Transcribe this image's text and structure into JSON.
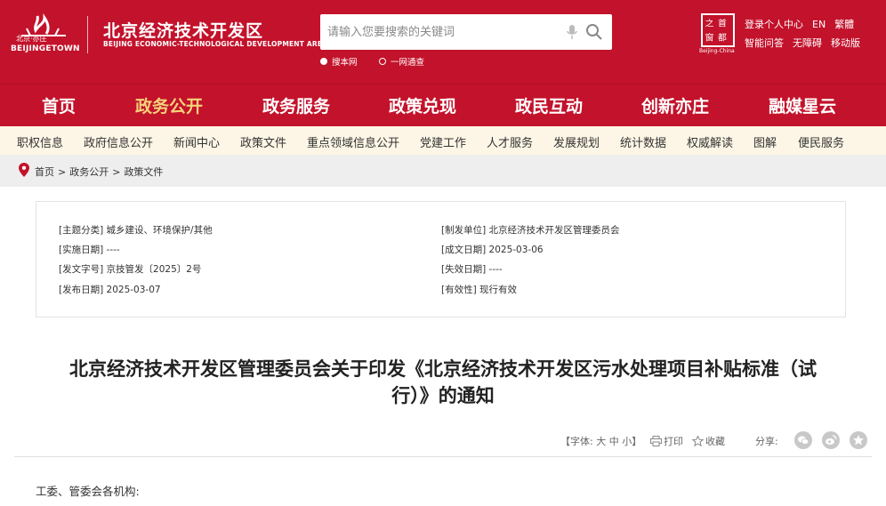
{
  "header": {
    "logo_sub": "北京·亦庄",
    "logo_en": "BEIJINGETOWN",
    "site_name": "北京经济技术开发区",
    "site_name_en": "BEIJING ECONOMIC-TECHNOLOGICAL DEVELOPMENT AREA",
    "search_placeholder": "请输入您要搜索的关键词",
    "scope_options": [
      "搜本网",
      "一网通查"
    ],
    "capital_text": [
      "之",
      "首",
      "都",
      "窗"
    ],
    "capital_sub": "Beijing-China",
    "top_links": [
      "登录",
      "个人中心",
      "EN",
      "繁體",
      "智能问答",
      "无障碍",
      "移动版"
    ],
    "brand_color": "#c3122b"
  },
  "main_nav": {
    "items": [
      "首页",
      "政务公开",
      "政务服务",
      "政策兑现",
      "政民互动",
      "创新亦庄",
      "融媒星云"
    ],
    "active": "政务公开"
  },
  "sub_nav": {
    "items": [
      "职权信息",
      "政府信息公开",
      "新闻中心",
      "政策文件",
      "重点领域信息公开",
      "党建工作",
      "人才服务",
      "发展规划",
      "统计数据",
      "权威解读",
      "图解",
      "便民服务"
    ]
  },
  "breadcrumb": [
    "首页",
    ">",
    "政务公开",
    ">",
    "政策文件"
  ],
  "meta": {
    "subject": "[主题分类] 城乡建设、环境保护/其他",
    "effective_date": "[实施日期] ----",
    "doc_number": "[发文字号] 京技管发〔2025〕2号",
    "publish_date": "[发布日期] 2025-03-07",
    "issuer": "[制发单位] 北京经济技术开发区管理委员会",
    "written_date": "[成文日期] 2025-03-06",
    "expiry_date": "[失效日期] ----",
    "validity": "[有效性] 现行有效"
  },
  "article": {
    "title_line1": "北京经济技术开发区管理委员会关于印发《北京经济技术开发区污水处理项目补贴标准（试",
    "title_line2": "行）》的通知",
    "opening": "工委、管委会各机构:"
  },
  "tools": {
    "font_label": "【字体:",
    "font_large": "大",
    "font_medium": "中",
    "font_small": "小",
    "font_end": "】",
    "print": "打印",
    "favorite": "收藏",
    "share_label": "分享:",
    "share_icons": [
      "wechat-icon",
      "weibo-icon",
      "star-icon"
    ]
  }
}
